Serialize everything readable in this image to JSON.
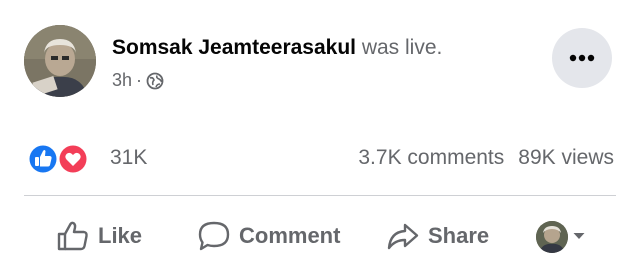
{
  "post": {
    "author_name": "Somsak Jeamteerasakul",
    "status_suffix": " was live.",
    "timestamp": "3h",
    "separator": "·",
    "privacy_icon": "globe-icon",
    "more_icon": "more-horizontal-icon"
  },
  "stats": {
    "reaction_icons": [
      "like-reaction-icon",
      "love-reaction-icon"
    ],
    "reaction_count": "31K",
    "comments": "3.7K comments",
    "views": "89K views"
  },
  "actions": {
    "like_label": "Like",
    "comment_label": "Comment",
    "share_label": "Share",
    "audience_icon": "chevron-down-icon"
  },
  "colors": {
    "like_blue": "#1877f2",
    "love_red": "#f33e58",
    "secondary_text": "#65676b",
    "button_bg": "#e4e6eb"
  }
}
